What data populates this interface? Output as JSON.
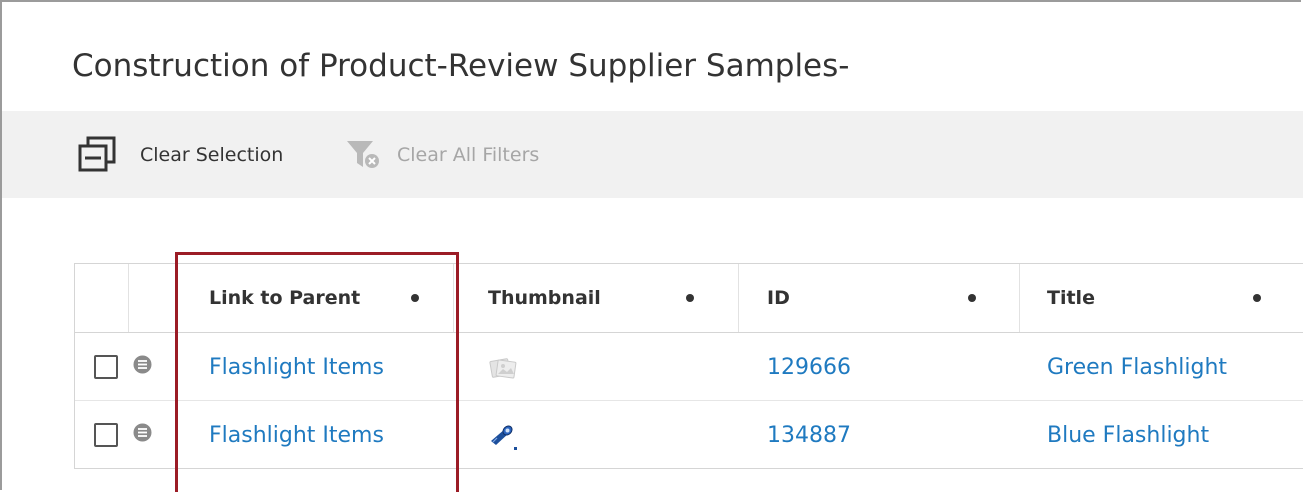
{
  "page": {
    "title": "Construction of Product-Review Supplier Samples-"
  },
  "toolbar": {
    "clear_selection_label": "Clear Selection",
    "clear_selection_icon": "clear-selection-icon",
    "clear_filters_label": "Clear All Filters",
    "clear_filters_icon": "filter-clear-icon",
    "clear_filters_enabled": false
  },
  "grid": {
    "columns": [
      {
        "label": "Link to Parent"
      },
      {
        "label": "Thumbnail"
      },
      {
        "label": "ID"
      },
      {
        "label": "Title"
      }
    ],
    "rows": [
      {
        "checked": false,
        "link_to_parent": "Flashlight Items",
        "thumbnail": "placeholder-image-icon",
        "id": "129666",
        "title": "Green Flashlight"
      },
      {
        "checked": false,
        "link_to_parent": "Flashlight Items",
        "thumbnail": "blue-flashlight-image",
        "id": "134887",
        "title": "Blue Flashlight"
      }
    ]
  },
  "colors": {
    "link": "#1f7ac0",
    "text": "#333333",
    "disabled_text": "#a6a6a6",
    "toolbar_bg": "#f1f1f1",
    "highlight_border": "#9b1c26"
  }
}
